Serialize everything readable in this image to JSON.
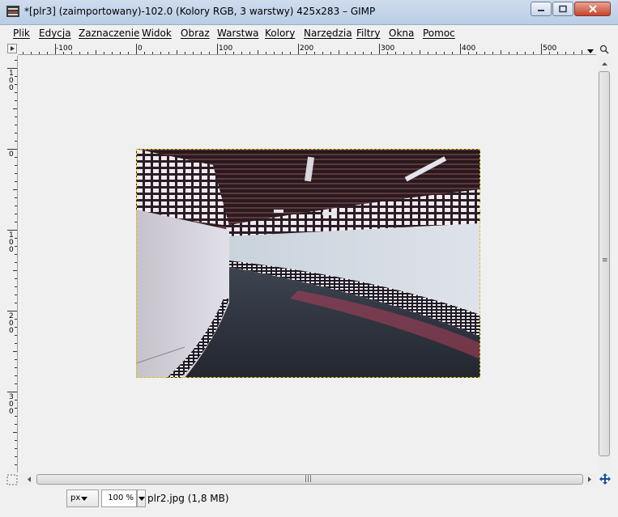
{
  "window": {
    "title": "*[plr3] (zaimportowany)-102.0 (Kolory RGB, 3 warstwy) 425x283 – GIMP"
  },
  "menu": [
    {
      "label": "Plik"
    },
    {
      "label": "Edycja"
    },
    {
      "label": "Zaznaczenie"
    },
    {
      "label": "Widok"
    },
    {
      "label": "Obraz"
    },
    {
      "label": "Warstwa"
    },
    {
      "label": "Kolory"
    },
    {
      "label": "Narzędzia"
    },
    {
      "label": "Filtry"
    },
    {
      "label": "Okna"
    },
    {
      "label": "Pomoc"
    }
  ],
  "rulers": {
    "horizontal": [
      "-100",
      "0",
      "100",
      "200",
      "300",
      "400",
      "500"
    ],
    "vertical": [
      "100",
      "0",
      "100",
      "200",
      "300"
    ]
  },
  "status": {
    "unit": "px",
    "zoom": "100 %",
    "file_info": "plr2.jpg (1,8 MB)"
  },
  "icons": {
    "ruler_corner": "menu-arrow-icon",
    "navigate": "zoom-fit-icon",
    "quick_mask": "quick-mask-icon",
    "nav_move": "navigate-cross-icon"
  }
}
